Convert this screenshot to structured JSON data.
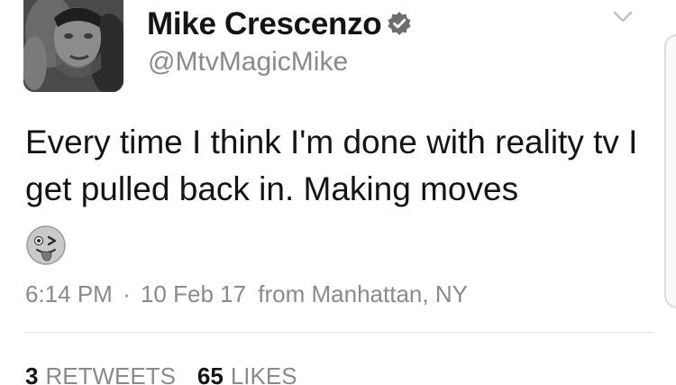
{
  "tweet": {
    "display_name": "Mike Crescenzo",
    "handle": "@MtvMagicMike",
    "text": "Every time I think I'm done with reality tv I get pulled back in. Making moves",
    "emoji": "winking-face-with-tongue",
    "time": "6:14 PM",
    "separator": "·",
    "date": "10 Feb 17",
    "location": "from Manhattan, NY",
    "retweets": {
      "count": "3",
      "label": "RETWEETS"
    },
    "likes": {
      "count": "65",
      "label": "LIKES"
    }
  },
  "icons": {
    "verified": "verified-badge-icon",
    "menu": "chevron-down-icon"
  },
  "colors": {
    "text_primary": "#141414",
    "text_secondary": "#8a8a8a",
    "verified_badge": "#6e6e6e",
    "divider": "#e1e1e1"
  }
}
